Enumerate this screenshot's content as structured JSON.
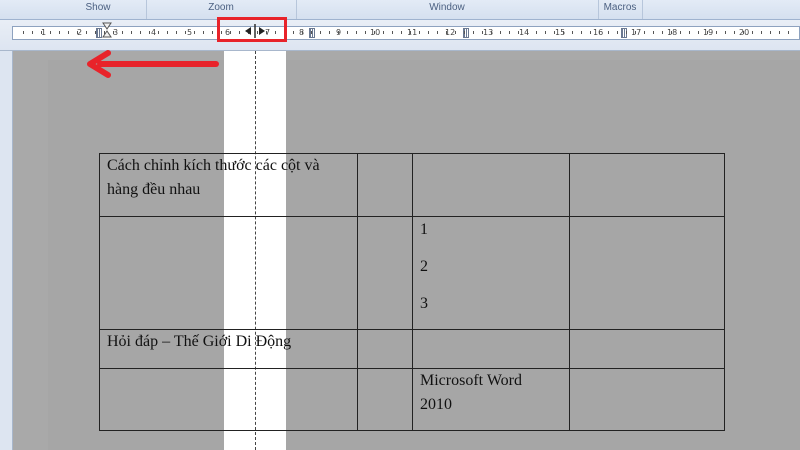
{
  "ribbon": {
    "groups": [
      "Show",
      "Zoom",
      "Window",
      "Macros"
    ]
  },
  "ruler": {
    "numbers": [
      "1",
      "2",
      "3",
      "4",
      "5",
      "6",
      "7",
      "8",
      "9",
      "10",
      "11",
      "12",
      "13",
      "14",
      "15",
      "16",
      "17",
      "18",
      "19",
      "20"
    ]
  },
  "table": {
    "r1c1": "Cách chỉnh kích thước các cột và hàng đều nhau",
    "r2c3": [
      "1",
      "2",
      "3"
    ],
    "r3c1": "Hỏi đáp – Thế Giới Di Động",
    "r4c3": "Microsoft Word 2010"
  },
  "annotation": {
    "color": "#e8232a"
  }
}
